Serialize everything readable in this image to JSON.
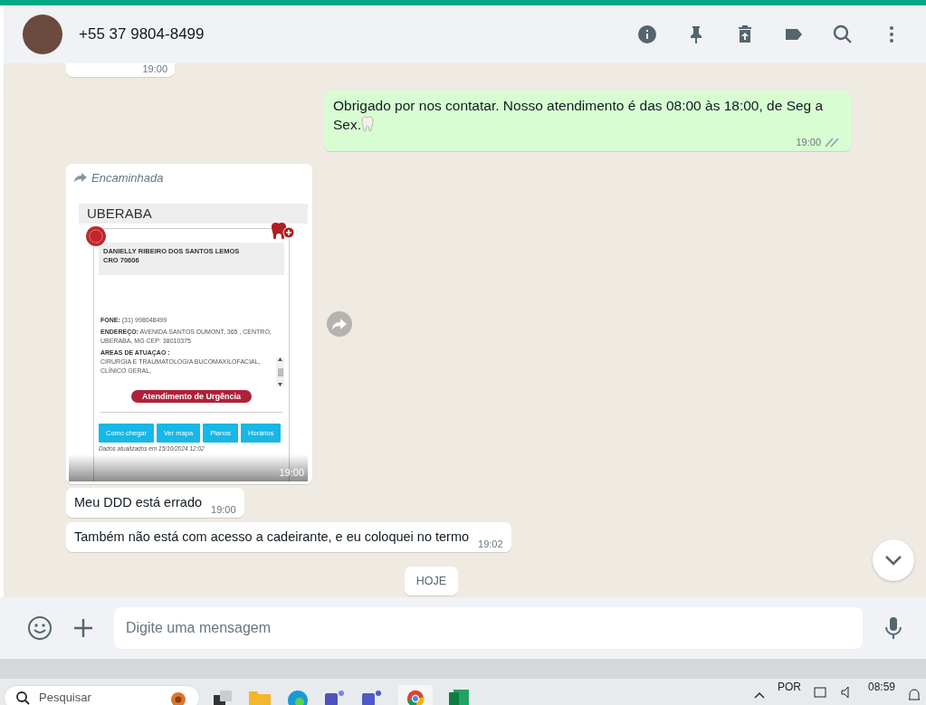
{
  "header": {
    "contact": "+55 37 9804-8499"
  },
  "messages": [
    {
      "kind": "clipped",
      "outgoing": false,
      "time": "19:00"
    },
    {
      "kind": "text",
      "outgoing": true,
      "text": "Obrigado por nos contatar. Nosso atendimento é das 08:00 às 18:00, de Seg a Sex.",
      "time": "19:00",
      "read": false
    },
    {
      "kind": "image",
      "outgoing": false,
      "forwarded_label": "Encaminhada",
      "time": "19:00",
      "card": {
        "city": "UBERABA",
        "name": "DANIELLY RIBEIRO DOS SANTOS LEMOS",
        "registry": "CRO 70606",
        "fields": [
          {
            "label": "FONE:",
            "value": "(31) 998048499"
          },
          {
            "label": "ENDEREÇO:",
            "value": "AVENIDA SANTOS DUMONT, 365 , CENTRO, UBERABA, MG CEP: 38010375"
          }
        ],
        "areas_label": "AREAS DE ATUAÇAO :",
        "areas": "CIRURGIA E TRAUMATOLOGIA BUCOMAXILOFACIAL, CLÍNICO GERAL,",
        "urgent": "Atendimento de Urgência",
        "buttons": [
          "Como chegar",
          "Ver mapa",
          "Planos",
          "Horários"
        ],
        "updated": "Dados atualizados em 15/10/2024 12:02"
      }
    },
    {
      "kind": "text",
      "outgoing": false,
      "text": "Meu DDD está errado",
      "time": "19:00"
    },
    {
      "kind": "text",
      "outgoing": false,
      "text": "Também não está com acesso a cadeirante, e eu coloquei no termo",
      "time": "19:02"
    },
    {
      "kind": "date",
      "text": "HOJE"
    }
  ],
  "composer": {
    "placeholder": "Digite uma mensagem"
  },
  "taskbar": {
    "search_placeholder": "Pesquisar",
    "language": "POR",
    "time": "08:59"
  }
}
